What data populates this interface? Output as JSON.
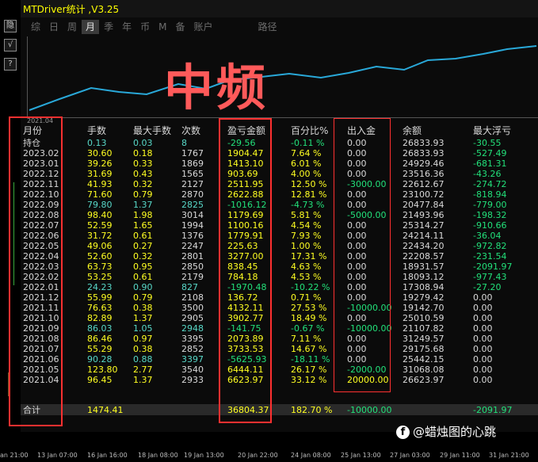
{
  "window": {
    "title": "MTDriver统计 ,V3.25"
  },
  "side_buttons": [
    "隐",
    "√",
    "?"
  ],
  "tabs": [
    {
      "label": "综",
      "active": false
    },
    {
      "label": "日",
      "active": false
    },
    {
      "label": "周",
      "active": false
    },
    {
      "label": "月",
      "active": true
    },
    {
      "label": "季",
      "active": false
    },
    {
      "label": "年",
      "active": false
    },
    {
      "label": "币",
      "active": false
    },
    {
      "label": "M",
      "active": false
    },
    {
      "label": "备",
      "active": false
    },
    {
      "label": "账户",
      "active": false
    },
    {
      "label": "路径",
      "active": false
    }
  ],
  "chart": {
    "start_label": "2021.04",
    "line_color": "#29a8d8"
  },
  "overlay": {
    "text": "中频"
  },
  "table": {
    "columns": [
      "月份",
      "手数",
      "最大手数",
      "次数",
      "盈亏金额",
      "百分比%",
      "出入金",
      "余额",
      "最大浮亏"
    ],
    "rows": [
      [
        "持仓",
        "0.13",
        "0.03",
        "8",
        "-29.56",
        "-0.11 %",
        "0.00",
        "26833.93",
        "-30.55"
      ],
      [
        "2023.02",
        "30.60",
        "0.18",
        "1767",
        "1904.47",
        "7.64 %",
        "0.00",
        "26833.93",
        "-527.49"
      ],
      [
        "2023.01",
        "39.26",
        "0.33",
        "1869",
        "1413.10",
        "6.01 %",
        "0.00",
        "24929.46",
        "-681.31"
      ],
      [
        "2022.12",
        "31.69",
        "0.43",
        "1565",
        "903.69",
        "4.00 %",
        "0.00",
        "23516.36",
        "-43.26"
      ],
      [
        "2022.11",
        "41.93",
        "0.32",
        "2127",
        "2511.95",
        "12.50 %",
        "-3000.00",
        "22612.67",
        "-274.72"
      ],
      [
        "2022.10",
        "71.60",
        "0.79",
        "2870",
        "2622.88",
        "12.81 %",
        "0.00",
        "23100.72",
        "-818.94"
      ],
      [
        "2022.09",
        "79.80",
        "1.37",
        "2825",
        "-1016.12",
        "-4.73 %",
        "0.00",
        "20477.84",
        "-779.00"
      ],
      [
        "2022.08",
        "98.40",
        "1.98",
        "3014",
        "1179.69",
        "5.81 %",
        "-5000.00",
        "21493.96",
        "-198.32"
      ],
      [
        "2022.07",
        "52.59",
        "1.65",
        "1994",
        "1100.16",
        "4.54 %",
        "0.00",
        "25314.27",
        "-910.66"
      ],
      [
        "2022.06",
        "31.72",
        "0.61",
        "1376",
        "1779.91",
        "7.93 %",
        "0.00",
        "24214.11",
        "-36.04"
      ],
      [
        "2022.05",
        "49.06",
        "0.27",
        "2247",
        "225.63",
        "1.00 %",
        "0.00",
        "22434.20",
        "-972.82"
      ],
      [
        "2022.04",
        "52.60",
        "0.32",
        "2801",
        "3277.00",
        "17.31 %",
        "0.00",
        "22208.57",
        "-231.54"
      ],
      [
        "2022.03",
        "63.73",
        "0.95",
        "2850",
        "838.45",
        "4.63 %",
        "0.00",
        "18931.57",
        "-2091.97"
      ],
      [
        "2022.02",
        "53.25",
        "0.61",
        "2179",
        "784.18",
        "4.53 %",
        "0.00",
        "18093.12",
        "-977.43"
      ],
      [
        "2022.01",
        "24.23",
        "0.90",
        "827",
        "-1970.48",
        "-10.22 %",
        "0.00",
        "17308.94",
        "-27.20"
      ],
      [
        "2021.12",
        "55.99",
        "0.79",
        "2108",
        "136.72",
        "0.71 %",
        "0.00",
        "19279.42",
        "0.00"
      ],
      [
        "2021.11",
        "76.63",
        "0.38",
        "3500",
        "4132.11",
        "27.53 %",
        "-10000.00",
        "19142.70",
        "0.00"
      ],
      [
        "2021.10",
        "82.89",
        "1.37",
        "2905",
        "3902.77",
        "18.49 %",
        "0.00",
        "25010.59",
        "0.00"
      ],
      [
        "2021.09",
        "86.03",
        "1.05",
        "2948",
        "-141.75",
        "-0.67 %",
        "-10000.00",
        "21107.82",
        "0.00"
      ],
      [
        "2021.08",
        "86.46",
        "0.97",
        "3395",
        "2073.89",
        "7.11 %",
        "0.00",
        "31249.57",
        "0.00"
      ],
      [
        "2021.07",
        "55.29",
        "0.38",
        "2852",
        "3733.53",
        "14.67 %",
        "0.00",
        "29175.68",
        "0.00"
      ],
      [
        "2021.06",
        "90.28",
        "0.88",
        "3397",
        "-5625.93",
        "-18.11 %",
        "0.00",
        "25442.15",
        "0.00"
      ],
      [
        "2021.05",
        "123.80",
        "2.77",
        "3540",
        "6444.11",
        "26.17 %",
        "-2000.00",
        "31068.08",
        "0.00"
      ],
      [
        "2021.04",
        "96.45",
        "1.37",
        "2933",
        "6623.97",
        "33.12 %",
        "20000.00",
        "26623.97",
        "0.00"
      ]
    ],
    "total": [
      "合计",
      "1474.41",
      "",
      "",
      "36804.37",
      "182.70 %",
      "-10000.00",
      "",
      "-2091.97"
    ]
  },
  "time_axis": [
    "an 21:00",
    "13 Jan 07:00",
    "16 Jan 16:00",
    "18 Jan 08:00",
    "19 Jan 13:00",
    "20 Jan 22:00",
    "24 Jan 08:00",
    "25 Jan 13:00",
    "27 Jan 03:00",
    "29 Jan 11:00",
    "31 Jan 21:00"
  ],
  "watermark": {
    "logo": "f",
    "text": "@蜡烛图的心跳"
  }
}
